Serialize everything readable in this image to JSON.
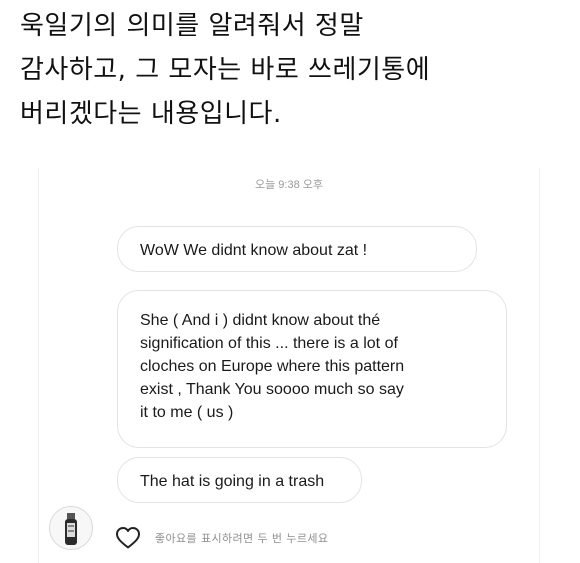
{
  "caption": {
    "lines": [
      "욱일기의 의미를 알려줘서 정말",
      "감사하고, 그 모자는 바로 쓰레기통에",
      "버리겠다는 내용입니다."
    ]
  },
  "dm": {
    "timestamp": "오늘 9:38 오후",
    "messages": [
      {
        "lines": [
          "WoW We didnt know about zat !"
        ]
      },
      {
        "lines": [
          "She ( And i ) didnt know about thé",
          "signification of this ... there is a lot of",
          "cloches on Europe where this pattern",
          "exist , Thank You soooo much so say",
          "it to me ( us )"
        ]
      },
      {
        "lines": [
          "The hat is going in a trash"
        ]
      }
    ],
    "like_hint": "좋아요를 표시하려면 두 번 누르세요"
  },
  "colors": {
    "bubble_border": "#e3e3e3",
    "timestamp": "#9a9a9a",
    "hint": "#8f8f8f"
  },
  "icons": {
    "avatar": "bottle-avatar",
    "like": "heart-icon"
  }
}
